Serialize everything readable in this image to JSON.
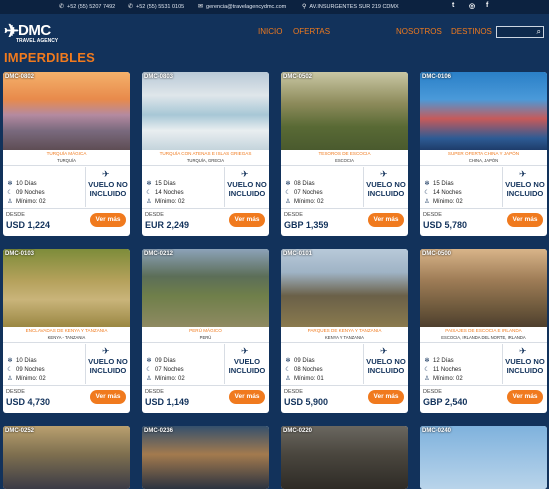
{
  "topbar": {
    "phone1": "+52 (55) 5207 7492",
    "phone2": "+52 (55) 5531 0105",
    "email": "gerencia@travelagencydmc.com",
    "address": "AV.INSURGENTES SUR 219 CDMX",
    "social": [
      "twitter-icon",
      "instagram-icon",
      "facebook-icon"
    ]
  },
  "brand": {
    "name": "DMC",
    "sub": "TRAVEL AGENCY"
  },
  "nav": {
    "inicio": "INICIO",
    "ofertas": "OFERTAS",
    "nosotros": "NOSOTROS",
    "destinos": "DESTINOS"
  },
  "section": {
    "title": "IMPERDIBLES"
  },
  "colors": {
    "navy": "#12325b",
    "orange": "#f07a1e"
  },
  "cards": [
    {
      "code": "DMC-0802",
      "title": "TURQUÍA MÁGICA",
      "country": "TURQUÍA",
      "days": "10 Días",
      "nights": "09 Noches",
      "minimo": "Mínimo: 02",
      "vuelo1": "VUELO NO",
      "vuelo2": "INCLUIDO",
      "desde": "DESDE",
      "price": "USD 1,224",
      "btn": "Ver más"
    },
    {
      "code": "DMC-0803",
      "title": "TURQUÍA CON ATENAS E ISLAS GRIEGAS",
      "country": "TURQUÍA, GRECIA",
      "days": "15 Días",
      "nights": "14 Noches",
      "minimo": "Mínimo: 02",
      "vuelo1": "VUELO NO",
      "vuelo2": "INCLUIDO",
      "desde": "DESDE",
      "price": "EUR 2,249",
      "btn": "Ver más"
    },
    {
      "code": "DMC-0502",
      "title": "TESOROS DE ESCOCIA",
      "country": "ESCOCIA",
      "days": "08 Días",
      "nights": "07 Noches",
      "minimo": "Mínimo: 02",
      "vuelo1": "VUELO NO",
      "vuelo2": "INCLUIDO",
      "desde": "DESDE",
      "price": "GBP 1,359",
      "btn": "Ver más"
    },
    {
      "code": "DMC-0106",
      "title": "SUPER OFERTA CHINA Y JAPÓN",
      "country": "CHINA, JAPÓN",
      "days": "15 Días",
      "nights": "14 Noches",
      "minimo": "Mínimo: 02",
      "vuelo1": "VUELO NO",
      "vuelo2": "INCLUIDO",
      "desde": "DESDE",
      "price": "USD 5,780",
      "btn": "Ver más"
    },
    {
      "code": "DMC-0103",
      "title": "ENCLAVADAS DE KENYA Y TANZANIA",
      "country": "KENYA - TANZANIA",
      "days": "10 Días",
      "nights": "09 Noches",
      "minimo": "Mínimo: 02",
      "vuelo1": "VUELO NO",
      "vuelo2": "INCLUIDO",
      "desde": "DESDE",
      "price": "USD 4,730",
      "btn": "Ver más"
    },
    {
      "code": "DMC-0212",
      "title": "PERÚ MÁGICO",
      "country": "PERÚ",
      "days": "09 Días",
      "nights": "07 Noches",
      "minimo": "Mínimo: 02",
      "vuelo1": "VUELO",
      "vuelo2": "INCLUIDO",
      "desde": "DESDE",
      "price": "USD 1,149",
      "btn": "Ver más"
    },
    {
      "code": "DMC-0101",
      "title": "PARQUES DE KENYA Y TANZANIA",
      "country": "KENYA Y TANZANIA",
      "days": "09 Días",
      "nights": "08 Noches",
      "minimo": "Mínimo: 01",
      "vuelo1": "VUELO NO",
      "vuelo2": "INCLUIDO",
      "desde": "DESDE",
      "price": "USD 5,900",
      "btn": "Ver más"
    },
    {
      "code": "DMC-0500",
      "title": "PAISAJES DE ESCOCIA E IRLANDA",
      "country": "ESCOCIA, IRLANDA DEL NORTE, IRLANDA",
      "days": "12 Días",
      "nights": "11 Noches",
      "minimo": "Mínimo: 02",
      "vuelo1": "VUELO NO",
      "vuelo2": "INCLUIDO",
      "desde": "DESDE",
      "price": "GBP 2,540",
      "btn": "Ver más"
    },
    {
      "code": "DMC-0252"
    },
    {
      "code": "DMC-0236"
    },
    {
      "code": "DMC-0220"
    },
    {
      "code": "DMC-0240"
    }
  ]
}
